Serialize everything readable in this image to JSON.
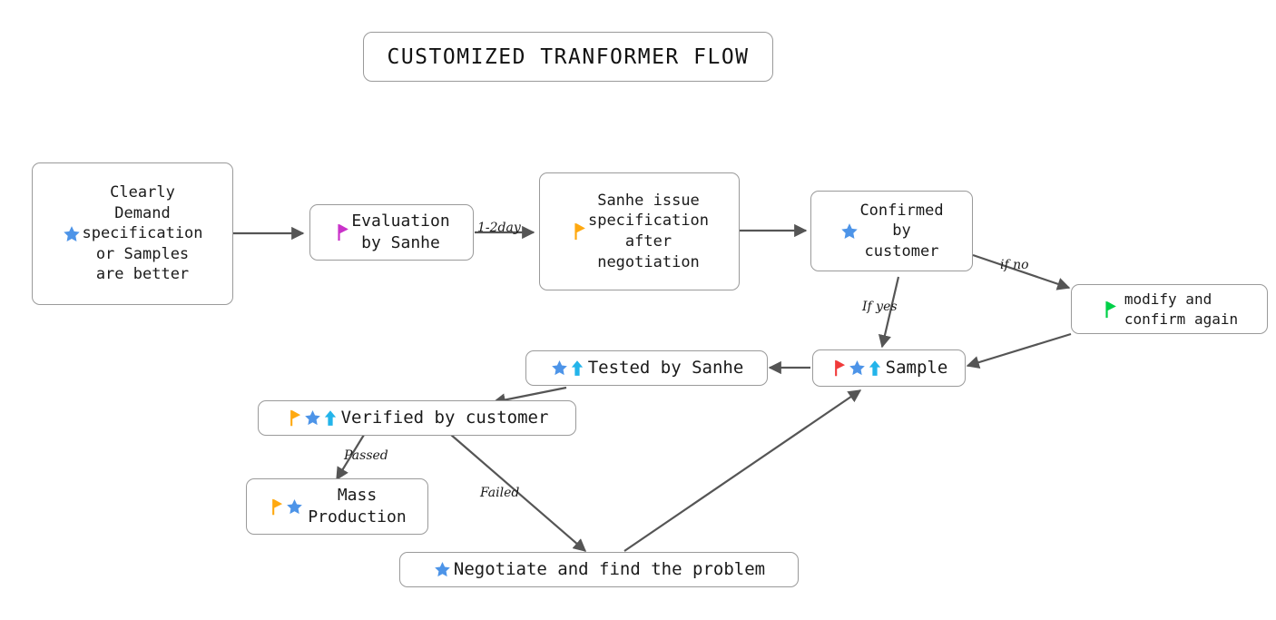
{
  "title": {
    "text": "CUSTOMIZED TRANFORMER FLOW"
  },
  "colors": {
    "flag_magenta": "#C932C9",
    "flag_orange": "#FFA910",
    "flag_green": "#00D048",
    "flag_red": "#F03A3A",
    "star_blue": "#4D94E8",
    "arrow_cyan": "#23B4EA",
    "edge_gray": "#555555",
    "border_gray": "#9a9a9a",
    "text_black": "#1a1a1a"
  },
  "nodes": [
    {
      "id": "clearly-demand",
      "label": "Clearly\nDemand\nspecification\nor Samples\nare better",
      "icons": [
        "star-blue-icon"
      ],
      "font_size": 17
    },
    {
      "id": "evaluation-by-sanhe",
      "label": "Evaluation\nby Sanhe",
      "icons": [
        "flag-magenta-icon"
      ],
      "font_size": 18
    },
    {
      "id": "sanhe-issue-specification",
      "label": "Sanhe issue\nspecification\nafter\nnegotiation",
      "icons": [
        "flag-orange-icon"
      ],
      "font_size": 17
    },
    {
      "id": "confirmed-by-customer",
      "label": "Confirmed\nby\ncustomer",
      "icons": [
        "star-blue-icon"
      ],
      "font_size": 17
    },
    {
      "id": "modify-and-confirm-again",
      "label": "modify and\nconfirm again",
      "icons": [
        "flag-green-icon"
      ],
      "font_size": 16
    },
    {
      "id": "sample",
      "label": "Sample",
      "icons": [
        "flag-red-icon",
        "star-blue-icon",
        "arrow-up-cyan-icon"
      ],
      "font_size": 19
    },
    {
      "id": "tested-by-sanhe",
      "label": "Tested by Sanhe",
      "icons": [
        "star-blue-icon",
        "arrow-up-cyan-icon"
      ],
      "font_size": 19
    },
    {
      "id": "verified-by-customer",
      "label": "Verified by customer",
      "icons": [
        "flag-orange-icon",
        "star-blue-icon",
        "arrow-up-cyan-icon"
      ],
      "font_size": 19
    },
    {
      "id": "mass-production",
      "label": "Mass\nProduction",
      "icons": [
        "flag-orange-icon",
        "star-blue-icon"
      ],
      "font_size": 18
    },
    {
      "id": "negotiate-find-problem",
      "label": "Negotiate and find the problem",
      "icons": [
        "star-blue-icon"
      ],
      "font_size": 19
    }
  ],
  "edge_labels": {
    "one_two_day": "1-2day",
    "if_no": "if no",
    "if_yes": "If yes",
    "passed": "Passed",
    "failed": "Failed"
  }
}
